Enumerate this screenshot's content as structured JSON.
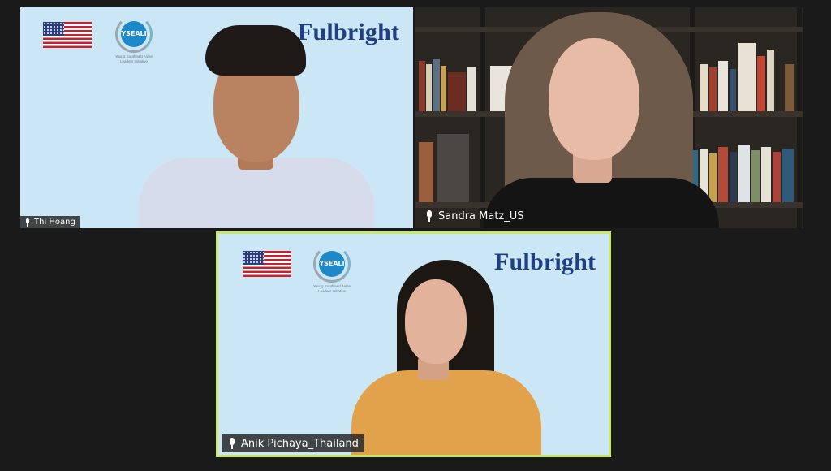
{
  "participants": [
    {
      "name": "Thi Hoang",
      "background": {
        "logo_text": "Fulbright",
        "badge_text": "YSEALI",
        "badge_subtext": "Young Southeast Asian Leaders Initiative"
      }
    },
    {
      "name": "Sandra Matz_US"
    },
    {
      "name": "Anik Pichaya_Thailand",
      "active_speaker": true,
      "background": {
        "logo_text": "Fulbright",
        "badge_text": "YSEALI",
        "badge_subtext": "Young Southeast Asian Leaders Initiative"
      }
    }
  ],
  "icons": {
    "mic": "microphone-icon",
    "flag": "us-flag-icon"
  },
  "colors": {
    "meeting_bg": "#1a1a1a",
    "virtual_bg": "#cbe7f5",
    "active_speaker_border": "#c8e86a",
    "fulbright_blue": "#1f3f82"
  }
}
